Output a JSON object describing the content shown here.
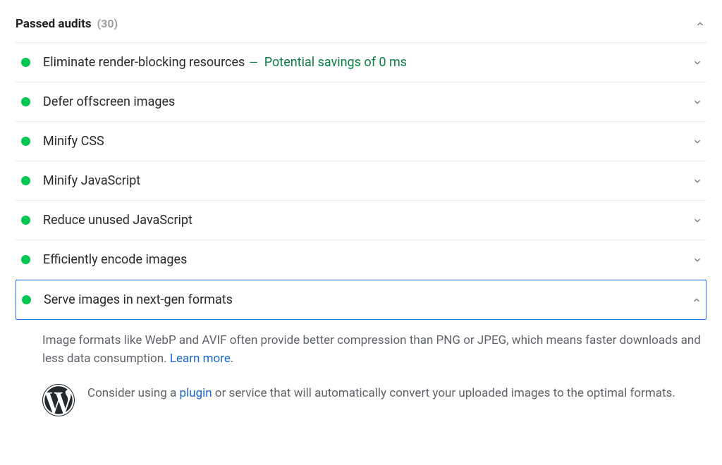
{
  "header": {
    "title": "Passed audits",
    "count": "(30)"
  },
  "audits": [
    {
      "title": "Eliminate render-blocking resources",
      "savings": "Potential savings of 0 ms",
      "expanded": false,
      "selected": false
    },
    {
      "title": "Defer offscreen images",
      "savings": null,
      "expanded": false,
      "selected": false
    },
    {
      "title": "Minify CSS",
      "savings": null,
      "expanded": false,
      "selected": false
    },
    {
      "title": "Minify JavaScript",
      "savings": null,
      "expanded": false,
      "selected": false
    },
    {
      "title": "Reduce unused JavaScript",
      "savings": null,
      "expanded": false,
      "selected": false
    },
    {
      "title": "Efficiently encode images",
      "savings": null,
      "expanded": false,
      "selected": false
    },
    {
      "title": "Serve images in next-gen formats",
      "savings": null,
      "expanded": true,
      "selected": true
    }
  ],
  "details": {
    "text_before_link": "Image formats like WebP and AVIF often provide better compression than PNG or JPEG, which means faster downloads and less data consumption. ",
    "learn_more": "Learn more",
    "text_after_link": "."
  },
  "wordpress_tip": {
    "text_before": "Consider using a ",
    "plugin_link": "plugin",
    "text_after": " or service that will automatically convert your uploaded images to the optimal formats."
  }
}
